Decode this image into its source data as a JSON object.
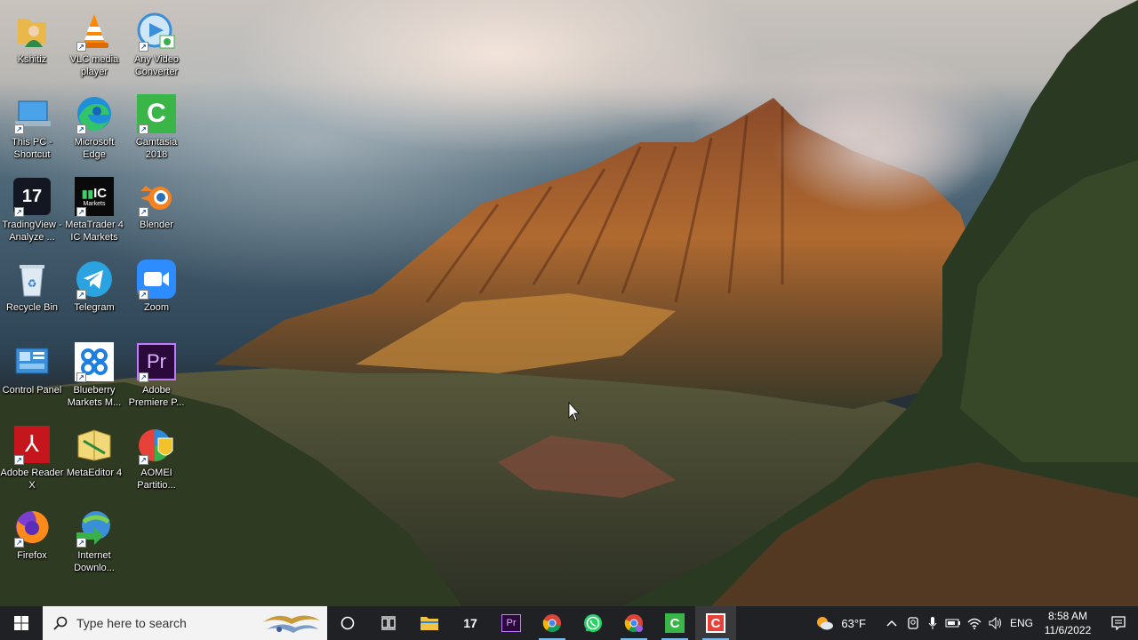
{
  "desktop": {
    "icons": [
      {
        "label": "Kshitiz",
        "icon": "user-folder-icon"
      },
      {
        "label": "VLC media player",
        "icon": "vlc-cone-icon"
      },
      {
        "label": "Any Video Converter",
        "icon": "video-converter-icon"
      },
      {
        "label": "This PC - Shortcut",
        "icon": "computer-icon"
      },
      {
        "label": "Microsoft Edge",
        "icon": "edge-icon"
      },
      {
        "label": "Camtasia 2018",
        "icon": "camtasia-icon"
      },
      {
        "label": "TradingView - Analyze ...",
        "icon": "tradingview-icon"
      },
      {
        "label": "MetaTrader 4 IC Markets",
        "icon": "metatrader-icon"
      },
      {
        "label": "Blender",
        "icon": "blender-icon"
      },
      {
        "label": "Recycle Bin",
        "icon": "recycle-bin-icon"
      },
      {
        "label": "Telegram",
        "icon": "telegram-icon"
      },
      {
        "label": "Zoom",
        "icon": "zoom-icon"
      },
      {
        "label": "Control Panel",
        "icon": "control-panel-icon"
      },
      {
        "label": "Blueberry Markets M...",
        "icon": "blueberry-icon"
      },
      {
        "label": "Adobe Premiere P...",
        "icon": "premiere-icon"
      },
      {
        "label": "Adobe Reader X",
        "icon": "acrobat-icon"
      },
      {
        "label": "MetaEditor 4",
        "icon": "metaeditor-icon"
      },
      {
        "label": "AOMEI Partitio...",
        "icon": "aomei-icon"
      },
      {
        "label": "Firefox",
        "icon": "firefox-icon"
      },
      {
        "label": "Internet Downlo...",
        "icon": "idm-icon"
      }
    ],
    "metatrader_logo_text": "IC",
    "metatrader_logo_sub": "Markets",
    "premiere_logo_text": "Pr"
  },
  "taskbar": {
    "search_placeholder": "Type here to search",
    "pinned": [
      {
        "name": "file-explorer",
        "icon": "folder-icon"
      },
      {
        "name": "tradingview",
        "icon": "tradingview-icon"
      },
      {
        "name": "premiere",
        "icon": "premiere-icon",
        "text": "Pr"
      },
      {
        "name": "chrome",
        "icon": "chrome-icon"
      },
      {
        "name": "whatsapp",
        "icon": "whatsapp-icon"
      },
      {
        "name": "chrome-profile",
        "icon": "chrome-icon"
      },
      {
        "name": "camtasia",
        "icon": "camtasia-icon"
      },
      {
        "name": "camtasia-recorder",
        "icon": "camtasia-recorder-icon"
      }
    ],
    "weather_temp": "63°F",
    "language": "ENG",
    "time": "8:58 AM",
    "date": "11/6/2022"
  },
  "colors": {
    "taskbar_bg": "#202124",
    "search_bg": "#f3f3f3",
    "active_indicator": "#76b9ed"
  }
}
